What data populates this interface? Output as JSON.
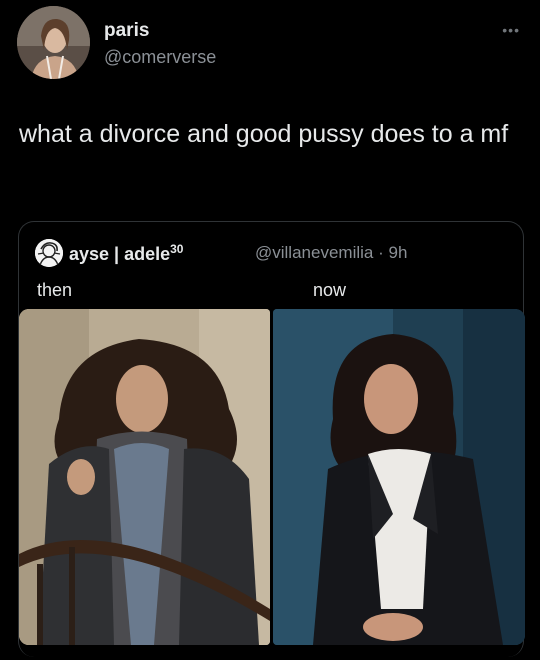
{
  "tweet": {
    "display_name": "paris",
    "handle": "@comerverse",
    "more_glyph": "•••",
    "text": "what a divorce and good pussy does to a mf"
  },
  "quote": {
    "display_name": "ayse | adele",
    "name_superscript": "30",
    "handle": "@villanevemilia",
    "separator": "·",
    "time": "9h",
    "label_left": "then",
    "label_right": "now",
    "image_left_icon": "photo-then",
    "image_right_icon": "photo-now"
  },
  "colors": {
    "background": "#000000",
    "text_primary": "#e7e9ea",
    "text_secondary": "#8b9096",
    "border": "#2f3336"
  }
}
